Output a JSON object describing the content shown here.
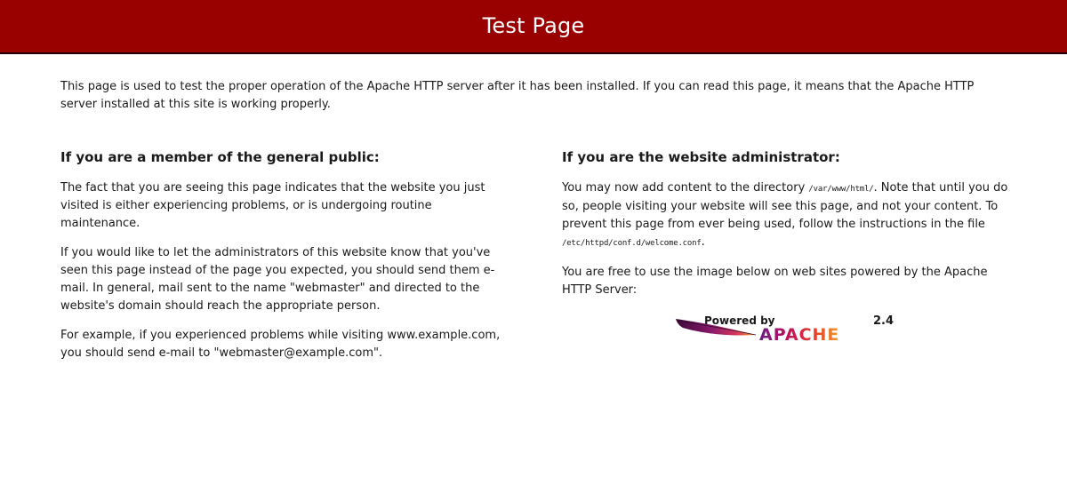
{
  "header": {
    "title": "Test Page",
    "background_color": "#990000"
  },
  "intro": {
    "text": "This page is used to test the proper operation of the Apache HTTP server after it has been installed. If you can read this page, it means that the Apache HTTP server installed at this site is working properly."
  },
  "public_section": {
    "heading": "If you are a member of the general public:",
    "paragraphs": [
      "The fact that you are seeing this page indicates that the website you just visited is either experiencing problems, or is undergoing routine maintenance.",
      "If you would like to let the administrators of this website know that you've seen this page instead of the page you expected, you should send them e-mail. In general, mail sent to the name \"webmaster\" and directed to the website's domain should reach the appropriate person.",
      "For example, if you experienced problems while visiting www.example.com, you should send e-mail to \"webmaster@example.com\"."
    ]
  },
  "admin_section": {
    "heading": "If you are the website administrator:",
    "p1_before": "You may now add content to the directory ",
    "p1_dir": "/var/www/html/",
    "p1_middle": ". Note that until you do so, people visiting your website will see this page, and not your content. To prevent this page from ever being used, follow the instructions in the file ",
    "p1_file": "/etc/httpd/conf.d/welcome.conf",
    "p1_after": ".",
    "p2": "You are free to use the image below on web sites powered by the Apache HTTP Server:"
  },
  "logo": {
    "powered_by": "Powered by",
    "brand": "APACHE",
    "version": "2.4",
    "brand_color": "#c0105a",
    "feather_color": "#6a1b6a"
  }
}
